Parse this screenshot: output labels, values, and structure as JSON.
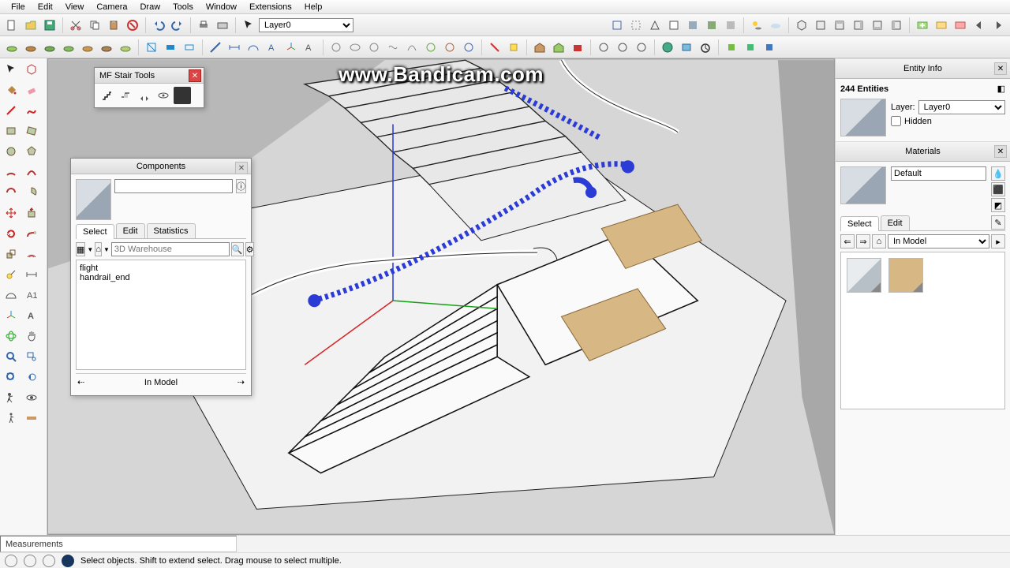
{
  "menu": [
    "File",
    "Edit",
    "View",
    "Camera",
    "Draw",
    "Tools",
    "Window",
    "Extensions",
    "Help"
  ],
  "watermark": "www.Bandicam.com",
  "layer_selector": {
    "current": "Layer0"
  },
  "stair_tools": {
    "title": "MF Stair Tools"
  },
  "components": {
    "title": "Components",
    "tabs": [
      "Select",
      "Edit",
      "Statistics"
    ],
    "active_tab": 0,
    "search_placeholder": "3D Warehouse",
    "items": [
      "flight",
      "handrail_end"
    ],
    "footer": "In Model"
  },
  "entity_info": {
    "title": "Entity Info",
    "count_label": "244 Entities",
    "layer_label": "Layer:",
    "layer_value": "Layer0",
    "hidden_label": "Hidden"
  },
  "materials": {
    "title": "Materials",
    "current_name": "Default",
    "tabs": [
      "Select",
      "Edit"
    ],
    "active_tab": 0,
    "scope": "In Model"
  },
  "measurements_label": "Measurements",
  "status_hint": "Select objects. Shift to extend select. Drag mouse to select multiple."
}
